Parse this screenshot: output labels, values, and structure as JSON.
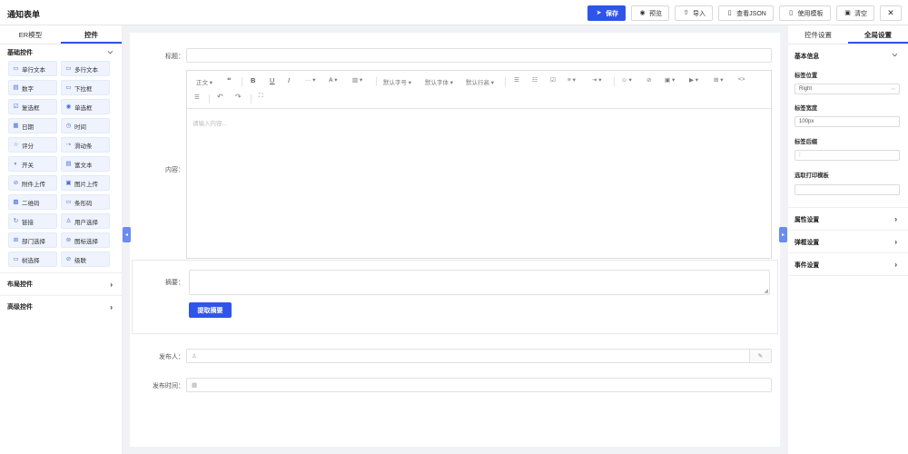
{
  "app_title": "通知表单",
  "toolbar": {
    "save": "保存",
    "preview": "预览",
    "import": "导入",
    "view_json": "查看JSON",
    "use_template": "使用模板",
    "clear": "清空"
  },
  "left_panel": {
    "tabs": [
      "ER模型",
      "控件"
    ],
    "basic_section": "基础控件",
    "widgets": [
      {
        "label": "单行文本",
        "icon": "▭"
      },
      {
        "label": "多行文本",
        "icon": "▭"
      },
      {
        "label": "数字",
        "icon": "▤"
      },
      {
        "label": "下拉框",
        "icon": "▭"
      },
      {
        "label": "复选框",
        "icon": "☑"
      },
      {
        "label": "单选框",
        "icon": "◉"
      },
      {
        "label": "日期",
        "icon": "▦"
      },
      {
        "label": "时间",
        "icon": "◷"
      },
      {
        "label": "评分",
        "icon": "☆"
      },
      {
        "label": "滑动条",
        "icon": "⇢"
      },
      {
        "label": "开关",
        "icon": "◐"
      },
      {
        "label": "富文本",
        "icon": "▤"
      },
      {
        "label": "附件上传",
        "icon": "⊘"
      },
      {
        "label": "图片上传",
        "icon": "▣"
      },
      {
        "label": "二维码",
        "icon": "▩"
      },
      {
        "label": "条形码",
        "icon": "▭"
      },
      {
        "label": "链接",
        "icon": "↻"
      },
      {
        "label": "用户选择",
        "icon": "♙"
      },
      {
        "label": "部门选择",
        "icon": "⊞"
      },
      {
        "label": "图标选择",
        "icon": "⊚"
      },
      {
        "label": "树选择",
        "icon": "▭"
      },
      {
        "label": "级联",
        "icon": "⊘"
      }
    ],
    "layout_section": "布局控件",
    "advanced_section": "高级控件"
  },
  "form": {
    "title_label": "标题：",
    "content_label": "内容：",
    "editor": {
      "paragraph": "正文",
      "font_size": "默认字号",
      "font_family": "默认字体",
      "line_height": "默认行高",
      "placeholder": "请输入内容..."
    },
    "summary_label": "摘要：",
    "extract_button": "提取摘要",
    "publisher_label": "发布人：",
    "publish_time_label": "发布时间："
  },
  "right_panel": {
    "tabs": [
      "控件设置",
      "全局设置"
    ],
    "basic_info": "基本信息",
    "label_position_label": "标签位置",
    "label_position_value": "Right",
    "label_width_label": "标签宽度",
    "label_width_value": "100px",
    "label_suffix_label": "标签后缀",
    "label_suffix_value": ":",
    "print_template_label": "选取打印模板",
    "sections": [
      "属性设置",
      "弹框设置",
      "事件设置"
    ]
  },
  "colors": {
    "primary": "#2f54eb",
    "handle": "#6b8cef",
    "canvas_bg": "#f0f2f5"
  }
}
